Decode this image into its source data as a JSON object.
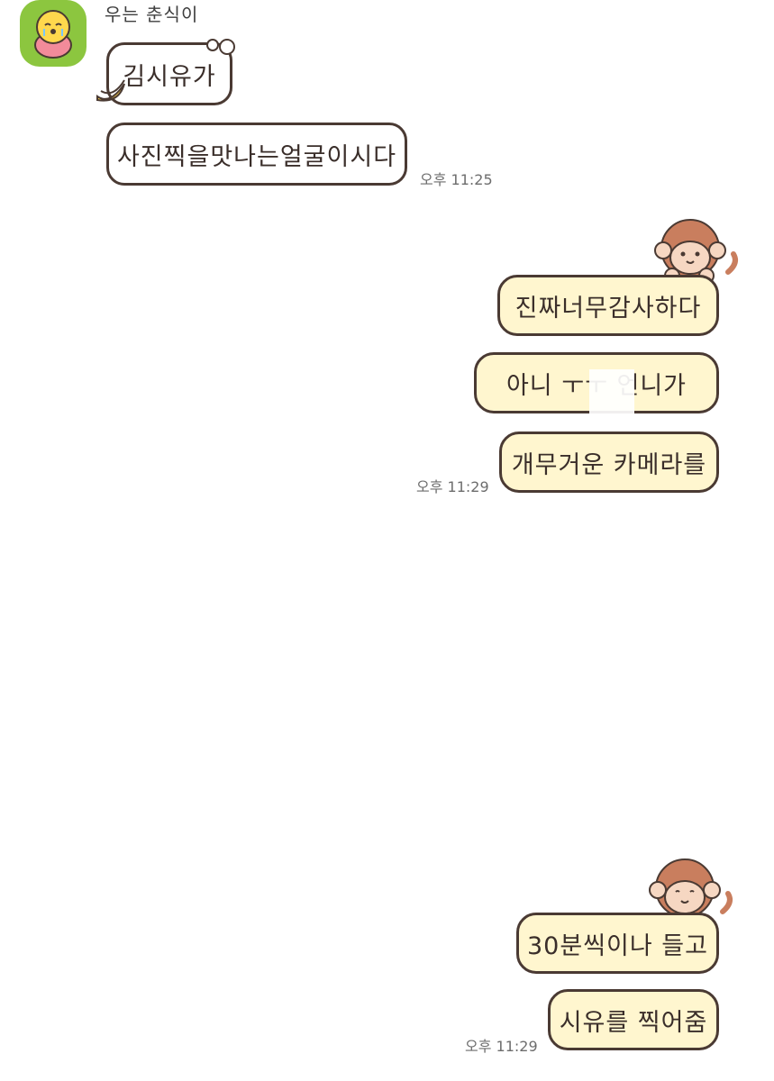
{
  "sender": {
    "name": "우는 춘식이",
    "avatar_icon": "chunsik-crying-icon",
    "avatar_color": "#8cc63f"
  },
  "received_messages": [
    {
      "text": "김시유가"
    },
    {
      "text": "사진찍을맛나는얼굴이시다"
    }
  ],
  "received_time": "오후 11:25",
  "sent_group_1": {
    "messages": [
      {
        "text": "진짜너무감사하다"
      },
      {
        "text": "아니 ㅜㅜ        언니가"
      },
      {
        "text": "개무거운 카메라를"
      }
    ],
    "time": "오후 11:29",
    "sticker_icon": "monkey-peek-icon"
  },
  "sent_group_2": {
    "messages": [
      {
        "text": "30분씩이나 들고"
      },
      {
        "text": "시유를 찍어줌"
      }
    ],
    "time": "오후 11:29",
    "sticker_icon": "monkey-peek-icon"
  },
  "colors": {
    "sent_bubble": "#fff6cf",
    "received_bubble": "#ffffff",
    "bubble_border": "#4a3a33"
  }
}
